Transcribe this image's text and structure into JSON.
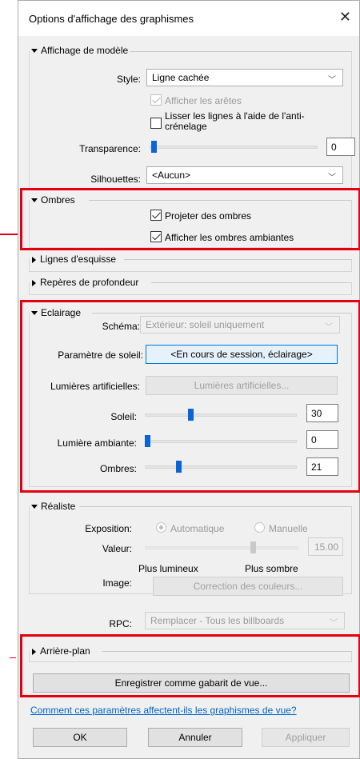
{
  "window": {
    "title": "Options d'affichage des graphismes"
  },
  "model_display": {
    "header": "Affichage de modèle",
    "style_label": "Style:",
    "style_value": "Ligne cachée",
    "show_edges_label": "Afficher les arêtes",
    "show_edges_checked": true,
    "smooth_lines_label": "Lisser les lignes à l'aide de l'anti-crénelage",
    "smooth_lines_checked": false,
    "transparency_label": "Transparence:",
    "transparency_value": "0",
    "silhouettes_label": "Silhouettes:",
    "silhouettes_value": "<Aucun>"
  },
  "shadows": {
    "header": "Ombres",
    "cast_label": "Projeter des ombres",
    "cast_checked": true,
    "ambient_label": "Afficher les ombres ambiantes",
    "ambient_checked": true
  },
  "sketchy_lines": {
    "header": "Lignes d'esquisse"
  },
  "depth_cueing": {
    "header": "Repères de profondeur"
  },
  "lighting": {
    "header": "Eclairage",
    "scheme_label": "Schéma:",
    "scheme_value": "Extérieur: soleil uniquement",
    "sun_setting_label": "Paramètre de soleil:",
    "sun_setting_button": "<En cours de session, éclairage>",
    "artificial_label": "Lumières artificielles:",
    "artificial_button": "Lumières artificielles...",
    "sun_label": "Soleil:",
    "sun_value": "30",
    "ambient_light_label": "Lumière ambiante:",
    "ambient_light_value": "0",
    "shadows_label": "Ombres:",
    "shadows_value": "21"
  },
  "realistic": {
    "header": "Réaliste",
    "exposure_label": "Exposition:",
    "auto_label": "Automatique",
    "manual_label": "Manuelle",
    "value_label": "Valeur:",
    "value_value": "15.00",
    "brighter_label": "Plus lumineux",
    "darker_label": "Plus sombre",
    "image_label": "Image:",
    "color_correction_button": "Correction des couleurs..."
  },
  "rpc": {
    "label": "RPC:",
    "value": "Remplacer - Tous les billboards"
  },
  "background": {
    "header": "Arrière-plan"
  },
  "save_template_button": "Enregistrer comme gabarit de vue...",
  "help_link": "Comment ces paramètres affectent-ils les graphismes de vue?",
  "footer": {
    "ok": "OK",
    "cancel": "Annuler",
    "apply": "Appliquer"
  },
  "colors": {
    "highlight": "#e3000f",
    "accent": "#0a64d8",
    "link": "#0066cc"
  }
}
